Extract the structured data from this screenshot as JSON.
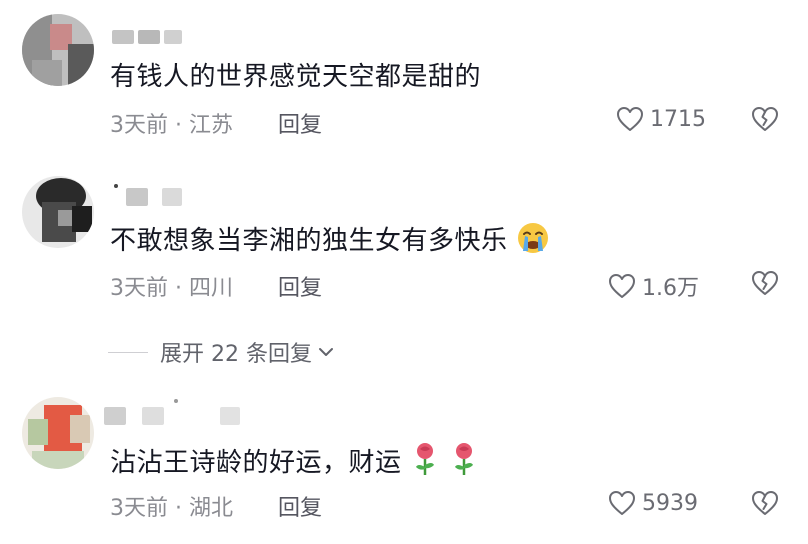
{
  "comments": [
    {
      "text": "有钱人的世界感觉天空都是甜的",
      "time": "3天前",
      "location": "江苏",
      "reply_label": "回复",
      "likes": "1715"
    },
    {
      "text": "不敢想象当李湘的独生女有多快乐",
      "time": "3天前",
      "location": "四川",
      "reply_label": "回复",
      "likes": "1.6万"
    },
    {
      "text": "沾沾王诗龄的好运，财运",
      "time": "3天前",
      "location": "湖北",
      "reply_label": "回复",
      "likes": "5939"
    }
  ],
  "expand_label": "展开 22 条回复",
  "separator": " · ",
  "icons": {
    "like": "heart-outline-icon",
    "dislike": "broken-heart-icon",
    "expand": "chevron-down-icon",
    "emoji_2": "crying-face-emoji",
    "emoji_3": "rose-emoji"
  },
  "colors": {
    "text": "#161823",
    "meta": "#8a8b91",
    "reply": "#555660"
  }
}
